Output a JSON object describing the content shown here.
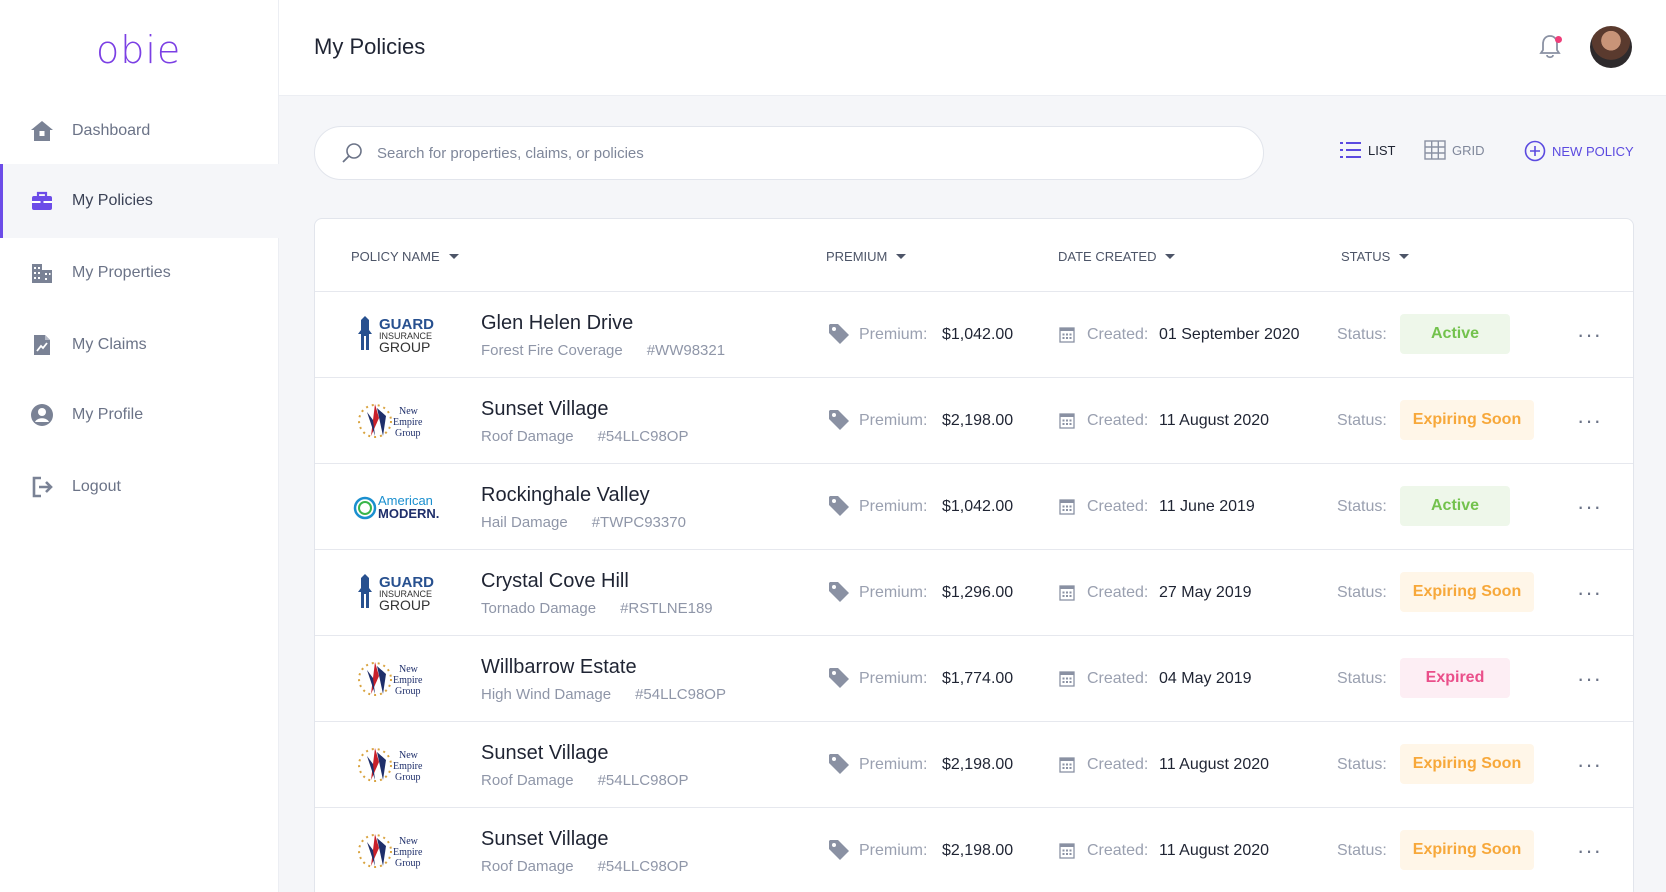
{
  "app": {
    "logo_text": "obie",
    "page_title": "My Policies"
  },
  "sidebar": {
    "items": [
      {
        "label": "Dashboard",
        "icon": "home-icon"
      },
      {
        "label": "My Policies",
        "icon": "briefcase-icon",
        "active": true
      },
      {
        "label": "My Properties",
        "icon": "buildings-icon"
      },
      {
        "label": "My Claims",
        "icon": "claim-document-icon"
      },
      {
        "label": "My Profile",
        "icon": "user-circle-icon"
      },
      {
        "label": "Logout",
        "icon": "logout-icon"
      }
    ]
  },
  "toolbar": {
    "search_placeholder": "Search for properties, claims, or policies",
    "list_label": "LIST",
    "grid_label": "GRID",
    "new_policy_label": "NEW POLICY"
  },
  "table": {
    "headers": [
      "POLICY NAME",
      "PREMIUM",
      "DATE CREATED",
      "STATUS"
    ],
    "premium_label": "Premium:",
    "created_label": "Created:",
    "status_label": "Status:",
    "more_label": "···",
    "rows": [
      {
        "insurer": "guard",
        "name": "Glen Helen Drive",
        "coverage": "Forest Fire Coverage",
        "number": "#WW98321",
        "premium": "$1,042.00",
        "created": "01 September 2020",
        "status": "Active",
        "status_kind": "active"
      },
      {
        "insurer": "newempire",
        "name": "Sunset Village",
        "coverage": "Roof Damage",
        "number": "#54LLC98OP",
        "premium": "$2,198.00",
        "created": "11 August 2020",
        "status": "Expiring Soon",
        "status_kind": "soon"
      },
      {
        "insurer": "american",
        "name": "Rockinghale Valley",
        "coverage": "Hail Damage",
        "number": "#TWPC93370",
        "premium": "$1,042.00",
        "created": "11 June 2019",
        "status": "Active",
        "status_kind": "active"
      },
      {
        "insurer": "guard",
        "name": "Crystal Cove Hill",
        "coverage": "Tornado Damage",
        "number": "#RSTLNE189",
        "premium": "$1,296.00",
        "created": "27 May 2019",
        "status": "Expiring Soon",
        "status_kind": "soon"
      },
      {
        "insurer": "newempire",
        "name": "Willbarrow Estate",
        "coverage": "High Wind Damage",
        "number": "#54LLC98OP",
        "premium": "$1,774.00",
        "created": "04 May 2019",
        "status": "Expired",
        "status_kind": "expired"
      },
      {
        "insurer": "newempire",
        "name": "Sunset Village",
        "coverage": "Roof Damage",
        "number": "#54LLC98OP",
        "premium": "$2,198.00",
        "created": "11 August 2020",
        "status": "Expiring Soon",
        "status_kind": "soon"
      },
      {
        "insurer": "newempire",
        "name": "Sunset Village",
        "coverage": "Roof Damage",
        "number": "#54LLC98OP",
        "premium": "$2,198.00",
        "created": "11 August 2020",
        "status": "Expiring Soon",
        "status_kind": "soon"
      }
    ]
  },
  "logos": {
    "guard": {
      "line1": "GUARD",
      "line2": "INSURANCE",
      "line3": "GROUP"
    },
    "newempire": {
      "line1": "New",
      "line2": "Empire",
      "line3": "Group"
    },
    "american": {
      "line1": "American",
      "line2": "MODERN."
    }
  },
  "colors": {
    "accent": "#6c4ce8",
    "active": "#73c24d",
    "soon": "#f7a83a",
    "expired": "#ea4f8a",
    "notification": "#ef3e7a"
  }
}
